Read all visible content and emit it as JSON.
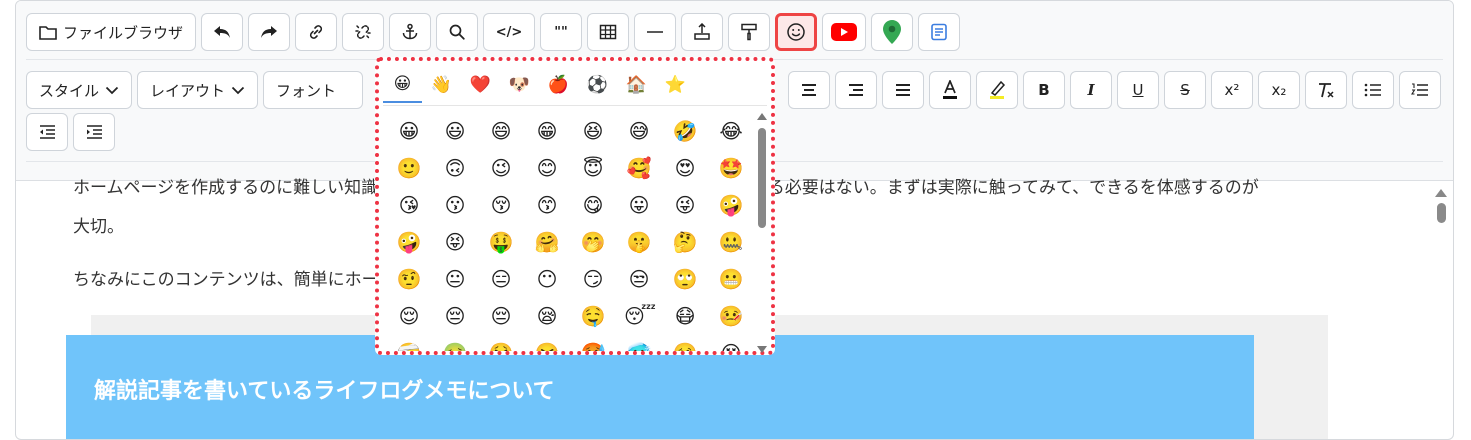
{
  "toolbar": {
    "file_browser_label": "ファイルブラウザ",
    "code_label": "</>",
    "quote_label": "\"\"",
    "style_label": "スタイル",
    "layout_label": "レイアウト",
    "font_label": "フォント",
    "bold_label": "B",
    "italic_label": "I",
    "underline_label": "U",
    "strike_label": "S",
    "superscript_label": "x²",
    "subscript_label": "x₂"
  },
  "content": {
    "para1_line1": "ホームページを作成するのに難しい知識は必要ない。ホームページに特殊な知識などを覚える必要はない。まずは実際に触ってみて、できるを体感するのが",
    "para1_line2": "大切。",
    "para2": "ちなみにこのコンテンツは、簡単にホームページを作るための解説記事。",
    "heading": "解説記事を書いているライフログメモについて"
  },
  "emoji_picker": {
    "categories": [
      "😀",
      "👋",
      "❤️",
      "🐶",
      "🍎",
      "⚽",
      "🏠",
      "⭐"
    ],
    "emojis": [
      [
        "😀",
        "😃",
        "😄",
        "😁",
        "😆",
        "😅",
        "🤣",
        "😂"
      ],
      [
        "🙂",
        "🙃",
        "😉",
        "😊",
        "😇",
        "🥰",
        "😍",
        "🤩"
      ],
      [
        "😘",
        "😗",
        "😚",
        "😙",
        "😋",
        "😛",
        "😜",
        "🤪"
      ],
      [
        "🤪",
        "😝",
        "🤑",
        "🤗",
        "🤭",
        "🤫",
        "🤔",
        "🤐"
      ],
      [
        "🤨",
        "😐",
        "😑",
        "😶",
        "😏",
        "😒",
        "🙄",
        "😬"
      ],
      [
        "😌",
        "😔",
        "😔",
        "😪",
        "🤤",
        "😴",
        "😷",
        "🤒"
      ],
      [
        "🤕",
        "🤢",
        "🤮",
        "🤧",
        "🥵",
        "🥶",
        "🥴",
        "😵"
      ]
    ]
  }
}
